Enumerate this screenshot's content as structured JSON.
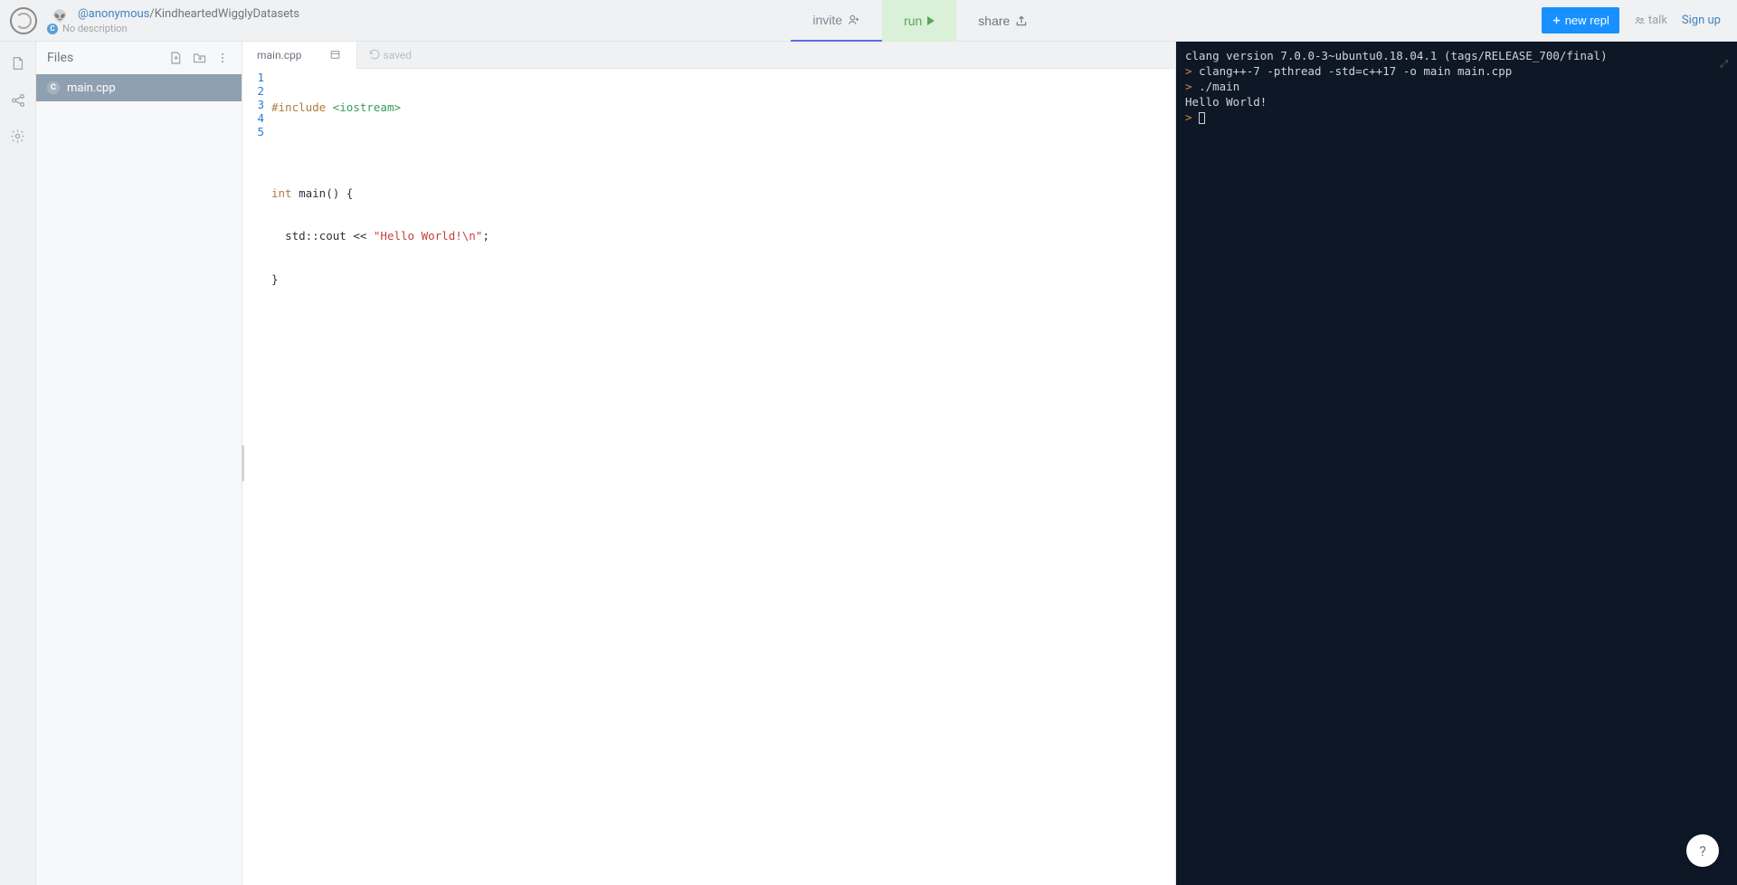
{
  "header": {
    "user": "@anonymous",
    "repl_name": "KindheartedWigglyDatasets",
    "description": "No description",
    "lang_initial": "C",
    "invite_label": "invite",
    "run_label": "run",
    "share_label": "share",
    "new_repl_label": "new repl",
    "talk_label": "talk",
    "signup_label": "Sign up"
  },
  "files_panel": {
    "title": "Files",
    "items": [
      {
        "name": "main.cpp",
        "lang_initial": "C"
      }
    ]
  },
  "editor": {
    "tab_name": "main.cpp",
    "saved_label": "saved",
    "lines": [
      "1",
      "2",
      "3",
      "4",
      "5"
    ],
    "code": {
      "l1_pre": "#include ",
      "l1_inc": "<iostream>",
      "l3_type": "int",
      "l3_fn": " main() {",
      "l4_indent": "  ",
      "l4_std": "std::cout << ",
      "l4_str": "\"Hello World!\\n\"",
      "l4_end": ";",
      "l5": "}"
    }
  },
  "terminal": {
    "l1": "clang version 7.0.0-3~ubuntu0.18.04.1 (tags/RELEASE_700/final)",
    "l2": "clang++-7 -pthread -std=c++17 -o main main.cpp",
    "l3": "./main",
    "l4": "Hello World!",
    "prompt": " "
  },
  "help_bubble": "?"
}
